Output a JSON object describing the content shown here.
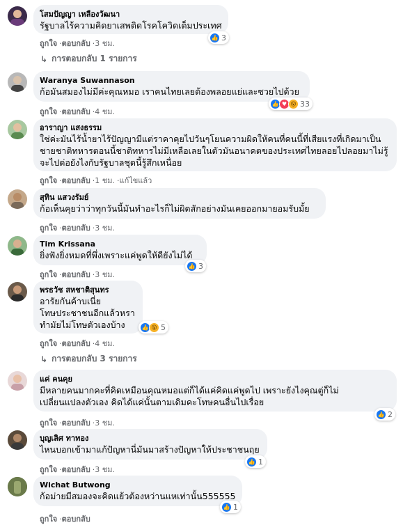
{
  "actions": {
    "like": "ถูกใจ",
    "reply": "ตอบกลับ",
    "dot": "·"
  },
  "comments": [
    {
      "name": "โสมปัญญา เหลืองวัฒนา",
      "text": "รัฐบาลไร้ความคิดยาเสพติดโรคโควิดเต็มประเทศ",
      "time": "3 ชม.",
      "reactions": [
        "like"
      ],
      "reaction_count": "3",
      "replies": "การตอบกลับ 1 รายการ"
    },
    {
      "name": "Waranya Suwannason",
      "text": "ก้อมันสมองไม่มีค่ะคุณหมอ เราคนไทยเลยต้องพลอยแย่และซวยไปด้วย",
      "time": "4 ชม.",
      "reactions": [
        "like",
        "love",
        "wow"
      ],
      "reaction_count": "33"
    },
    {
      "name": "อาราญา แสงธรรม",
      "text_lines": [
        "ใช่ค่ะมันไร้น้ำยาไร้ปัญญามีแต่ราคาคุยไปวันๆโยนความผิดให้คนที่คนนี้ที่เสียแรงที่เกิดมาเป็น",
        "ชายชาติทหารตอนนี้ชาติทหารไม่มีเหลือเลยในตัวมันอนาคตของประเทศไทยลอยไปลอยมาไม่รู้",
        "จะไปต่อยังไงกับรัฐบาลชุดนี้รู้สึกเหนื่อย"
      ],
      "time": "1 ชม.",
      "edited": "แก้ไขแล้ว"
    },
    {
      "name": "สุทิน แสวงรัมย์",
      "text": "ก้อเห็นคุยว่าว่าทุกวันนี้มันทำอะไรก็ไม่ผิดสักอย่างมันเคยออกมายอมรับมั้ย",
      "time": "3 ชม."
    },
    {
      "name": "Tim Krissana",
      "text": "ยิ่งฟังยิ่งหมดที่พึ่งเพราะแค่พูดให้ดียังไม่ได้",
      "time": "3 ชม.",
      "reactions": [
        "like"
      ],
      "reaction_count": "3"
    },
    {
      "name": "พรธวัช สหชาติสุนทร",
      "text_lines": [
        "อารัยกันค้าบเนี่ย",
        "โทษประชาชนอีกแล้วหรา",
        "ทำมัยไม่โทษตัวเองบ้าง"
      ],
      "time": "4 ชม.",
      "reactions": [
        "like",
        "wow"
      ],
      "reaction_count": "5",
      "replies": "การตอบกลับ 3 รายการ"
    },
    {
      "name": "แค่ คนคุย",
      "text_lines": [
        "มีหลายคนมากคะที่คิดเหมือนคุณหมอแต่ก็ได้แค่คิดแค่พูดไป เพราะยังไงคุณตู่ก็ไม่",
        "เปลี่ยนแปลงตัวเอง คิดได้แค่นั้นตามเดิมคะโทษคนอื่นไปเรื่อย"
      ],
      "time": "3 ชม.",
      "reactions": [
        "like"
      ],
      "reaction_count": "2"
    },
    {
      "name": "บุญเลิศ ทาทอง",
      "text": "ไหนบอกเข้ามาแก้ปัญหานี่มันมาสร้างปัญหาให้ประชาชนฤย",
      "time": "3 ชม.",
      "reactions": [
        "like"
      ],
      "reaction_count": "1"
    },
    {
      "name": "Wichat Butwong",
      "text": "ก้อม่ายมีสมองจะคิดแย้วต้องหว่านแหเท่านั้น555555",
      "time": "",
      "reactions": [
        "like"
      ],
      "reaction_count": "1"
    }
  ],
  "colors": {
    "bubble": "#f0f2f5",
    "meta": "#65676b",
    "like": "#1877f2",
    "love": "#f33e58",
    "wow": "#f7b125"
  },
  "icons": {
    "like": "thumbs-up-icon",
    "love": "heart-icon",
    "wow": "wow-face-icon",
    "reply": "reply-arrow-icon"
  }
}
